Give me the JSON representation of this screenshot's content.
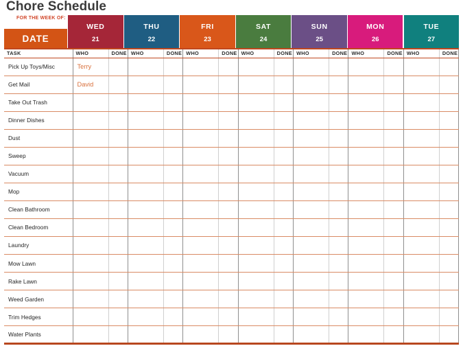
{
  "page": {
    "title": "Chore Schedule",
    "background_color": "#ffffff",
    "title_color": "#3b3b3b"
  },
  "header": {
    "week_of_label": "FOR THE WEEK OF:",
    "week_of_label_color": "#d1472a",
    "date_label": "DATE",
    "date_box_color": "#d35415",
    "days": [
      {
        "name": "WED",
        "date": "21",
        "color": "#a52638"
      },
      {
        "name": "THU",
        "date": "22",
        "color": "#1f5d82"
      },
      {
        "name": "FRI",
        "date": "23",
        "color": "#d9571a"
      },
      {
        "name": "SAT",
        "date": "24",
        "color": "#4a7c3f"
      },
      {
        "name": "SUN",
        "date": "25",
        "color": "#6b4f86"
      },
      {
        "name": "MON",
        "date": "26",
        "color": "#d81b7c"
      },
      {
        "name": "TUE",
        "date": "27",
        "color": "#10807e"
      }
    ]
  },
  "columns": {
    "task_header": "TASK",
    "who_header": "WHO",
    "done_header": "DONE"
  },
  "grid": {
    "line_color": "#d98a63",
    "divider_color": "#8d8d8d",
    "accent_color": "#c0471e",
    "entry_text_color": "#d9713d"
  },
  "rows": [
    {
      "task": "Pick Up Toys/Misc",
      "entries": [
        "Terry",
        "",
        "",
        "",
        "",
        "",
        ""
      ]
    },
    {
      "task": "Get Mail",
      "entries": [
        "David",
        "",
        "",
        "",
        "",
        "",
        ""
      ]
    },
    {
      "task": "Take Out Trash",
      "entries": [
        "",
        "",
        "",
        "",
        "",
        "",
        ""
      ]
    },
    {
      "task": "Dinner Dishes",
      "entries": [
        "",
        "",
        "",
        "",
        "",
        "",
        ""
      ]
    },
    {
      "task": "Dust",
      "entries": [
        "",
        "",
        "",
        "",
        "",
        "",
        ""
      ]
    },
    {
      "task": "Sweep",
      "entries": [
        "",
        "",
        "",
        "",
        "",
        "",
        ""
      ]
    },
    {
      "task": "Vacuum",
      "entries": [
        "",
        "",
        "",
        "",
        "",
        "",
        ""
      ]
    },
    {
      "task": "Mop",
      "entries": [
        "",
        "",
        "",
        "",
        "",
        "",
        ""
      ]
    },
    {
      "task": "Clean Bathroom",
      "entries": [
        "",
        "",
        "",
        "",
        "",
        "",
        ""
      ]
    },
    {
      "task": "Clean Bedroom",
      "entries": [
        "",
        "",
        "",
        "",
        "",
        "",
        ""
      ]
    },
    {
      "task": "Laundry",
      "entries": [
        "",
        "",
        "",
        "",
        "",
        "",
        ""
      ]
    },
    {
      "task": "Mow Lawn",
      "entries": [
        "",
        "",
        "",
        "",
        "",
        "",
        ""
      ]
    },
    {
      "task": "Rake Lawn",
      "entries": [
        "",
        "",
        "",
        "",
        "",
        "",
        ""
      ]
    },
    {
      "task": "Weed Garden",
      "entries": [
        "",
        "",
        "",
        "",
        "",
        "",
        ""
      ]
    },
    {
      "task": "Trim Hedges",
      "entries": [
        "",
        "",
        "",
        "",
        "",
        "",
        ""
      ]
    },
    {
      "task": "Water Plants",
      "entries": [
        "",
        "",
        "",
        "",
        "",
        "",
        ""
      ]
    }
  ]
}
